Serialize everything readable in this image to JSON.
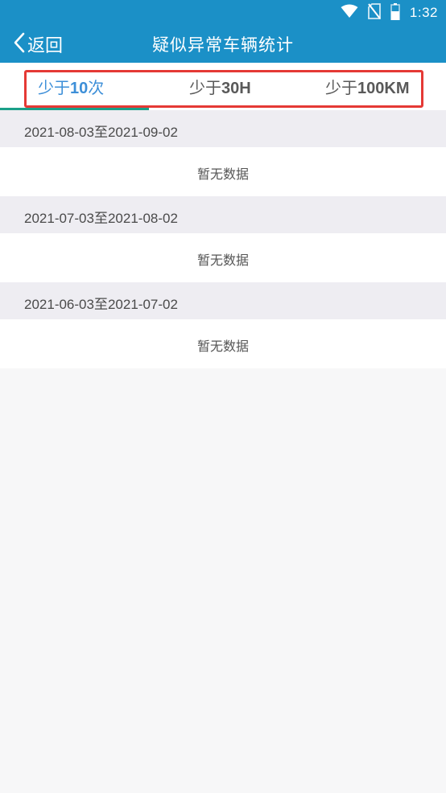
{
  "status_bar": {
    "time": "1:32",
    "icons": [
      "wifi-icon",
      "no-sim-icon",
      "battery-icon"
    ]
  },
  "header": {
    "back_label": "返回",
    "title": "疑似异常车辆统计"
  },
  "tabs": [
    {
      "prefix": "少于",
      "emphasis": "10",
      "suffix": "次",
      "active": true
    },
    {
      "prefix": "少于",
      "emphasis": "30H",
      "suffix": "",
      "active": false
    },
    {
      "prefix": "少于",
      "emphasis": "100KM",
      "suffix": "",
      "active": false
    }
  ],
  "sections": [
    {
      "date_range": "2021-08-03至2021-09-02",
      "empty_text": "暂无数据"
    },
    {
      "date_range": "2021-07-03至2021-08-02",
      "empty_text": "暂无数据"
    },
    {
      "date_range": "2021-06-03至2021-07-02",
      "empty_text": "暂无数据"
    }
  ],
  "colors": {
    "primary": "#1b90c7",
    "tab_active": "#3d8fd8",
    "tab_indicator": "#1aa089",
    "highlight_box": "#e53935"
  }
}
